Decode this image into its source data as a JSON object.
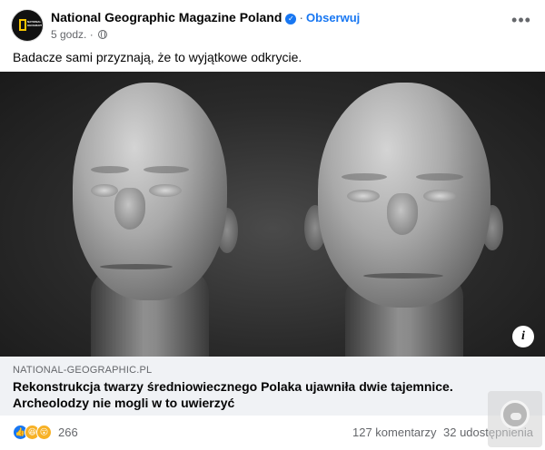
{
  "header": {
    "page_name": "National Geographic Magazine Poland",
    "follow_label": "Obserwuj",
    "time": "5 godz.",
    "separator": "·",
    "avatar_text": "NATIONAL GEOGRAPHIC",
    "icons": [
      "verified-badge-icon",
      "globe-icon",
      "more-icon"
    ]
  },
  "post": {
    "text": "Badacze sami przyznają, że to wyjątkowe odkrycie."
  },
  "link": {
    "domain": "NATIONAL-GEOGRAPHIC.PL",
    "title": "Rekonstrukcja twarzy średniowiecznego Polaka ujawniła dwie tajemnice. Archeolodzy nie mogli w to uwierzyć"
  },
  "footer": {
    "reaction_count": "266",
    "comments": "127 komentarzy",
    "shares": "32 udostępnienia",
    "reaction_icons": [
      "like-icon",
      "haha-icon",
      "wow-icon"
    ]
  },
  "colors": {
    "accent": "#1877f2",
    "card_bg": "#f0f2f5",
    "muted_text": "#65676b"
  }
}
